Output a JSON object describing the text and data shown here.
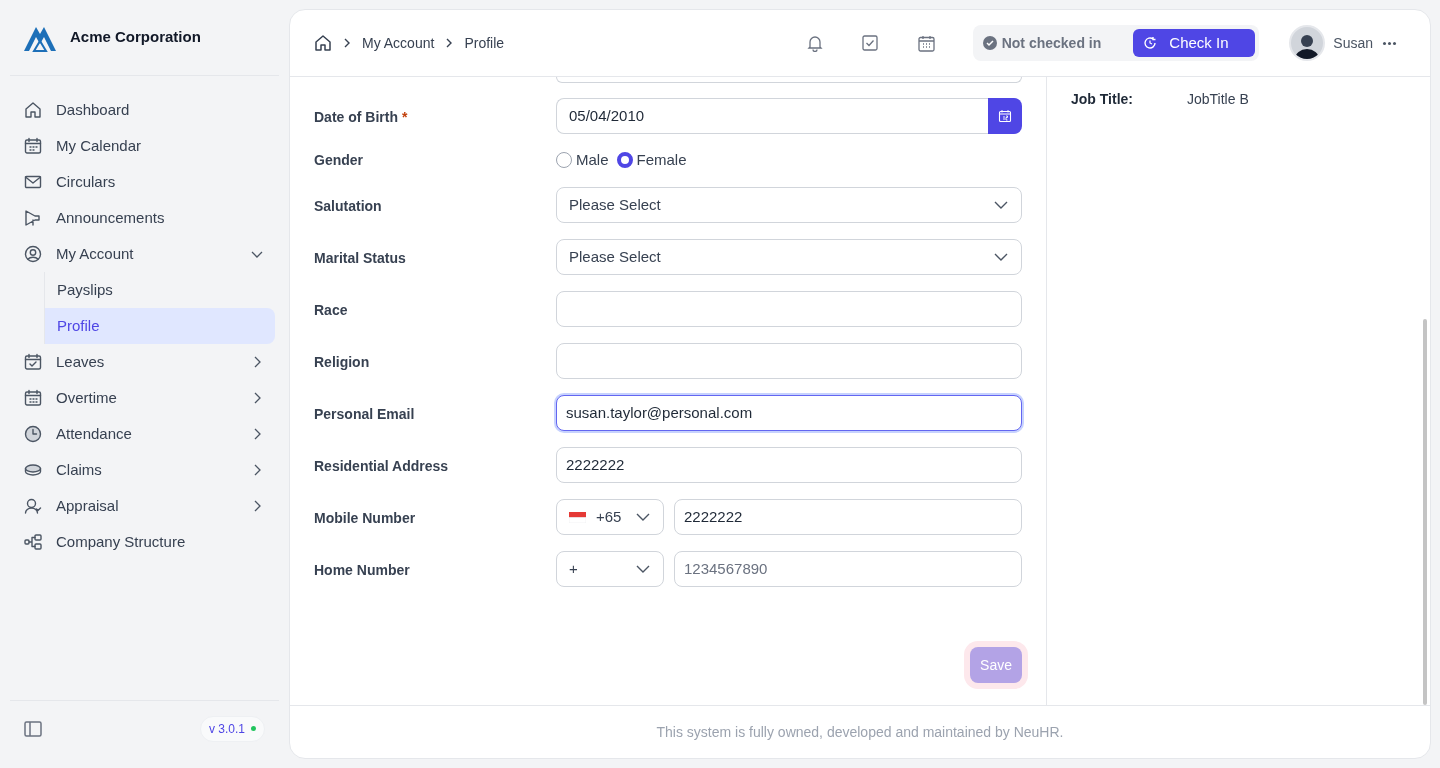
{
  "sidebar": {
    "brand": "Acme Corporation",
    "items": [
      {
        "label": "Dashboard",
        "selected": false
      },
      {
        "label": "My Calendar",
        "selected": false
      },
      {
        "label": "Circulars",
        "selected": false
      },
      {
        "label": "Announcements",
        "selected": false
      },
      {
        "label": "My Account",
        "selected": false,
        "expanded": true,
        "children": [
          {
            "label": "Payslips",
            "selected": false
          },
          {
            "label": "Profile",
            "selected": true
          }
        ]
      },
      {
        "label": "Leaves",
        "selected": false,
        "expanded": false
      },
      {
        "label": "Overtime",
        "selected": false,
        "expanded": false
      },
      {
        "label": "Attendance",
        "selected": false,
        "expanded": false
      },
      {
        "label": "Claims",
        "selected": false,
        "expanded": false
      },
      {
        "label": "Appraisal",
        "selected": false,
        "expanded": false
      },
      {
        "label": "Company Structure",
        "selected": false
      }
    ],
    "version": "v 3.0.1"
  },
  "header": {
    "breadcrumb": [
      "My Account",
      "Profile"
    ],
    "check_status": "Not checked in",
    "check_button": "Check In",
    "user": "Susan"
  },
  "form": {
    "fields": [
      {
        "kind": "date",
        "label": "Date of Birth",
        "required_mark": "*",
        "value": "05/04/2010",
        "focused": false
      },
      {
        "kind": "radio",
        "label": "Gender",
        "options": [
          {
            "label": "Male",
            "selected": false
          },
          {
            "label": "Female",
            "selected": true
          }
        ]
      },
      {
        "kind": "select",
        "label": "Salutation",
        "placeholder": "Please Select",
        "focused": false
      },
      {
        "kind": "select",
        "label": "Marital Status",
        "placeholder": "Please Select",
        "focused": false
      },
      {
        "kind": "text",
        "label": "Race",
        "focused": false
      },
      {
        "kind": "text",
        "label": "Religion",
        "focused": false
      },
      {
        "kind": "text",
        "label": "Personal Email",
        "value": "susan.taylor@personal.com",
        "focused": true
      },
      {
        "kind": "text",
        "label": "Residential Address",
        "value": "2222222",
        "focused": false
      },
      {
        "kind": "phone",
        "label": "Mobile Number",
        "code": "+65",
        "flag": true,
        "value": "2222222",
        "focused": false
      },
      {
        "kind": "phone",
        "label": "Home Number",
        "code": "+",
        "flag": false,
        "placeholder": "1234567890",
        "focused": false
      }
    ],
    "save_button": "Save"
  },
  "details": [
    {
      "label": "Job Title:",
      "value": "JobTitle B"
    }
  ],
  "footer": "This system is fully owned, developed and maintained by NeuHR."
}
